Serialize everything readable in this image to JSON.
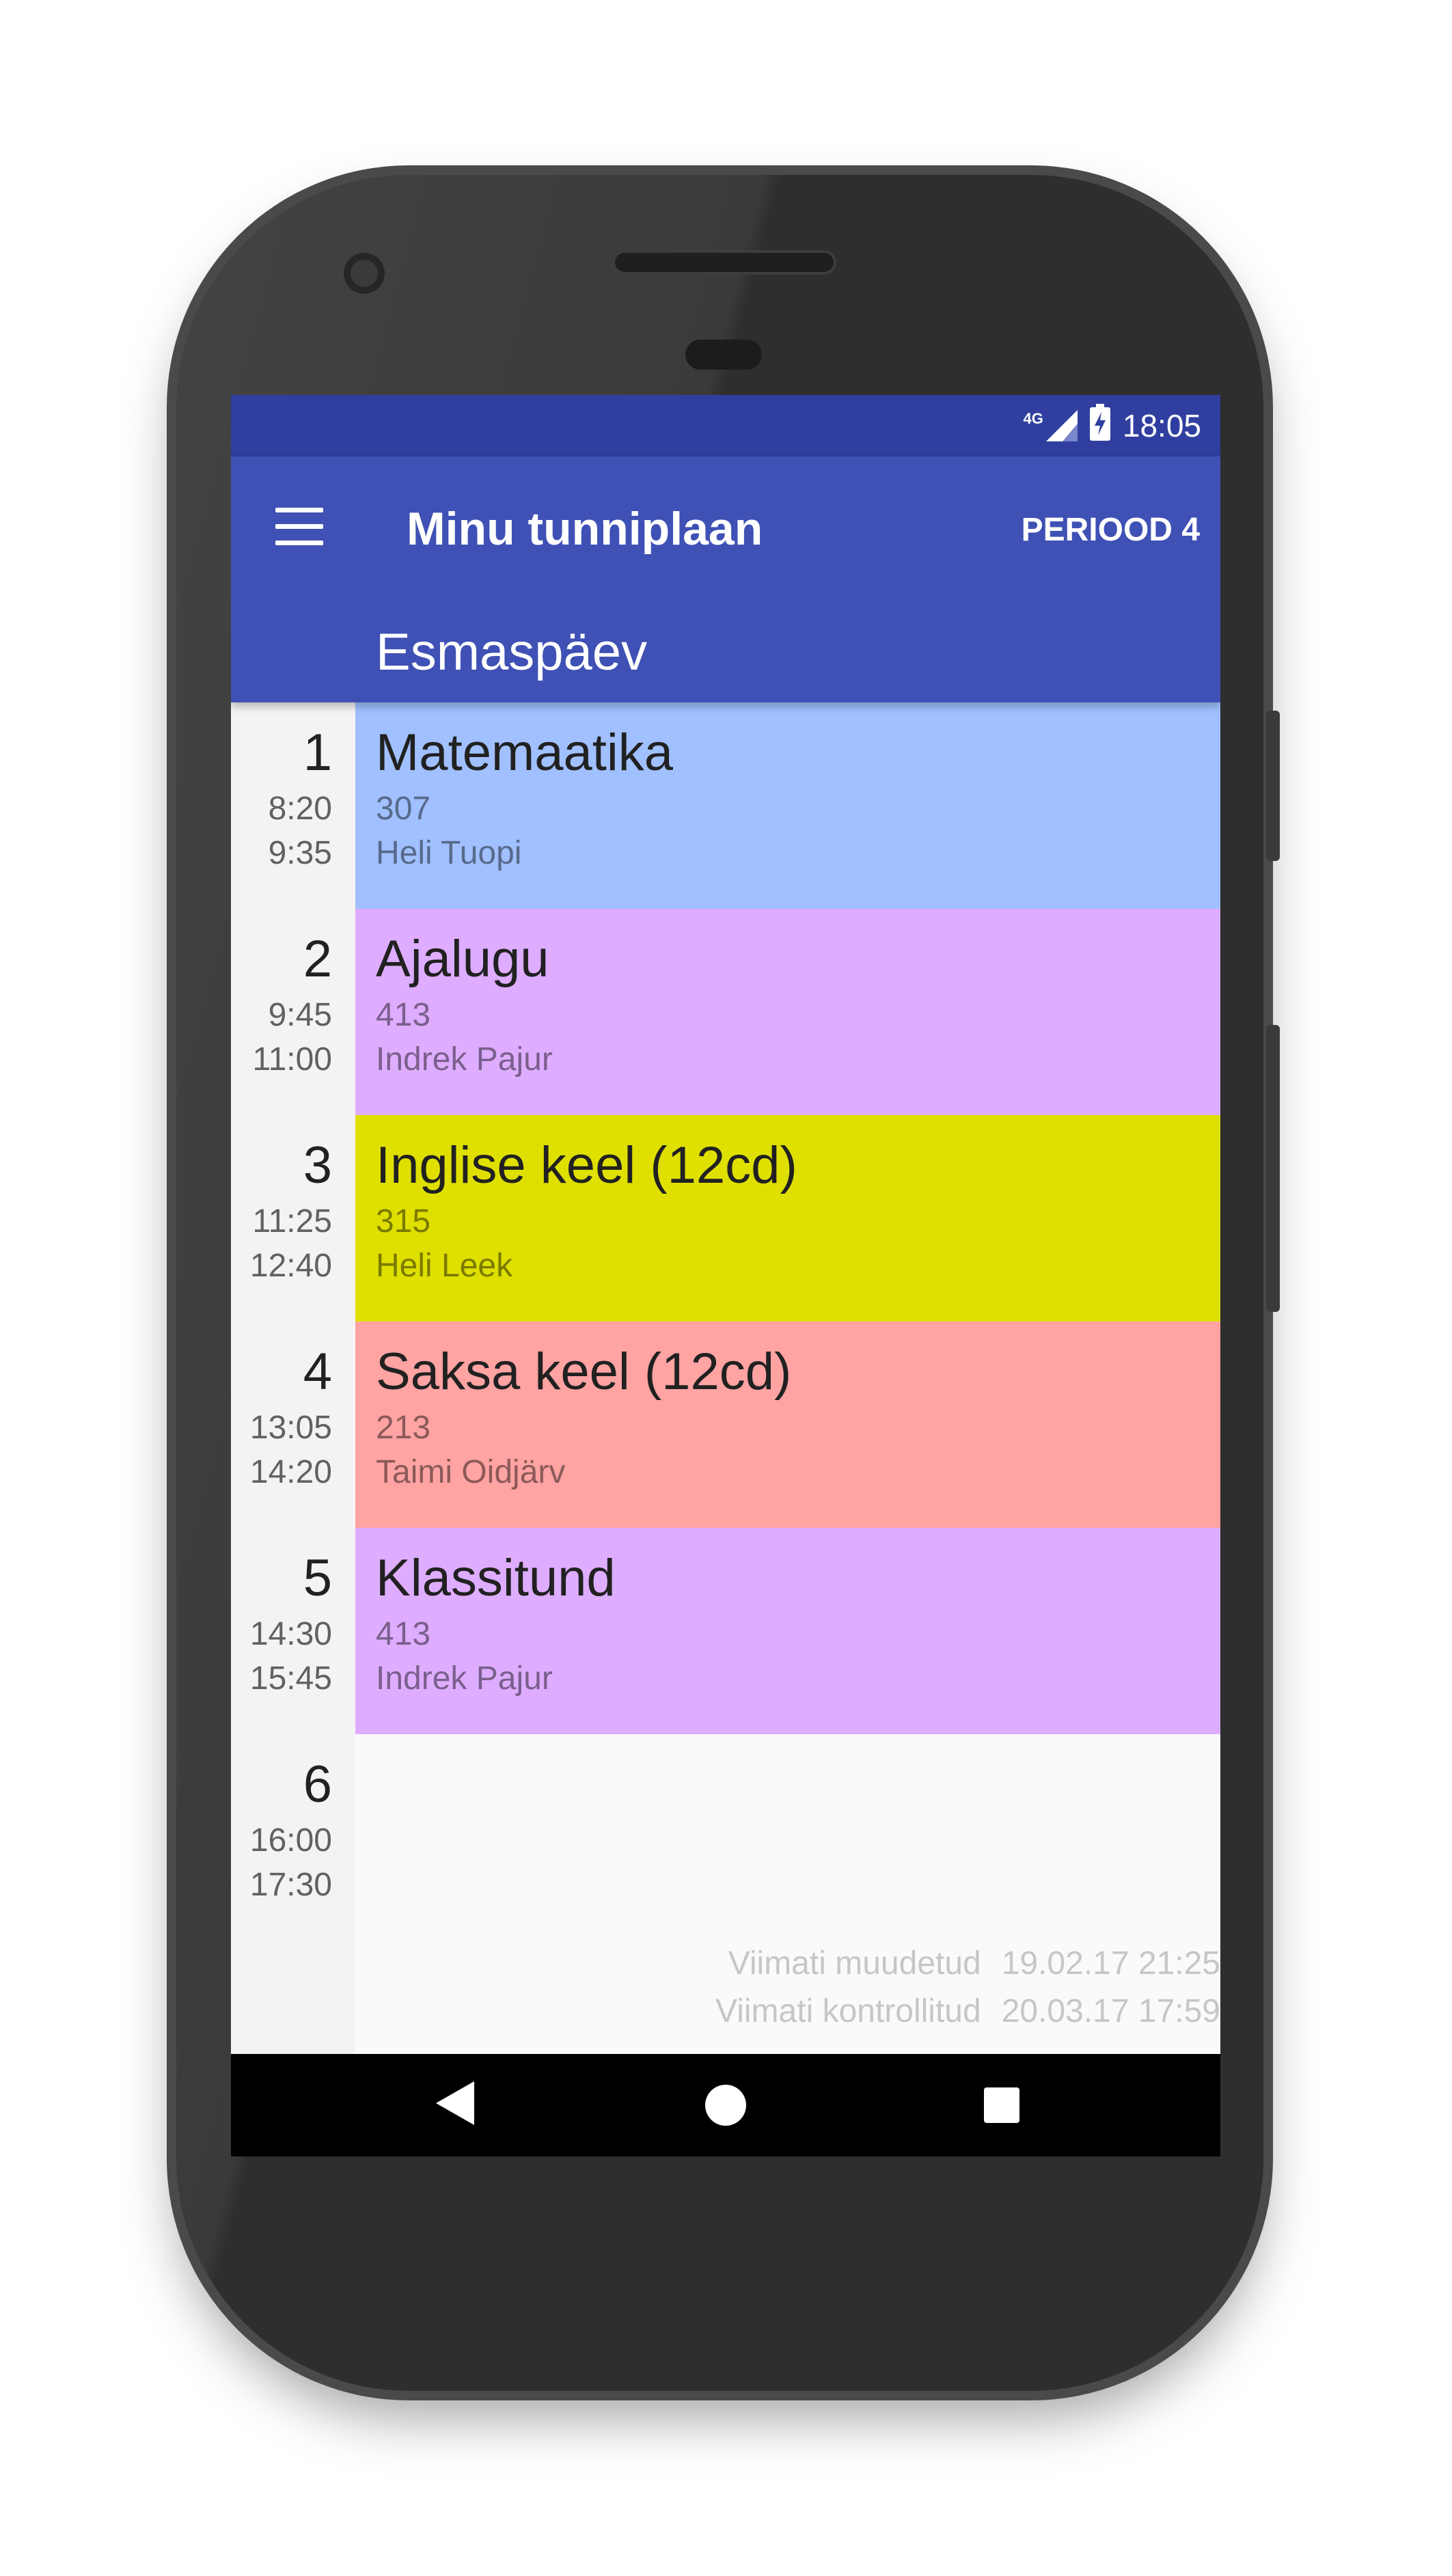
{
  "status": {
    "network": "4G",
    "time": "18:05"
  },
  "appbar": {
    "title": "Minu tunniplaan",
    "period_label": "PERIOOD 4",
    "day": "Esmaspäev"
  },
  "lessons": [
    {
      "num": "1",
      "start": "8:20",
      "end": "9:35",
      "name": "Matemaatika",
      "room": "307",
      "teacher": "Heli Tuopi",
      "color": "#a0c0ff"
    },
    {
      "num": "2",
      "start": "9:45",
      "end": "11:00",
      "name": "Ajalugu",
      "room": "413",
      "teacher": "Indrek Pajur",
      "color": "#deadff"
    },
    {
      "num": "3",
      "start": "11:25",
      "end": "12:40",
      "name": "Inglise keel (12cd)",
      "room": "315",
      "teacher": "Heli Leek",
      "color": "#dfdf00"
    },
    {
      "num": "4",
      "start": "13:05",
      "end": "14:20",
      "name": "Saksa keel (12cd)",
      "room": "213",
      "teacher": "Taimi Oidjärv",
      "color": "#ffa3a3"
    },
    {
      "num": "5",
      "start": "14:30",
      "end": "15:45",
      "name": "Klassitund",
      "room": "413",
      "teacher": "Indrek Pajur",
      "color": "#deadff"
    },
    {
      "num": "6",
      "start": "16:00",
      "end": "17:30",
      "name": "",
      "room": "",
      "teacher": "",
      "color": "#fafafa"
    }
  ],
  "footer": {
    "modified_label": "Viimati muudetud",
    "modified_value": "19.02.17 21:25",
    "checked_label": "Viimati kontrollitud",
    "checked_value": "20.03.17 17:59"
  },
  "navbar": {
    "back_icon": "back-icon",
    "home_icon": "home-icon",
    "recent_icon": "recent-apps-icon"
  }
}
